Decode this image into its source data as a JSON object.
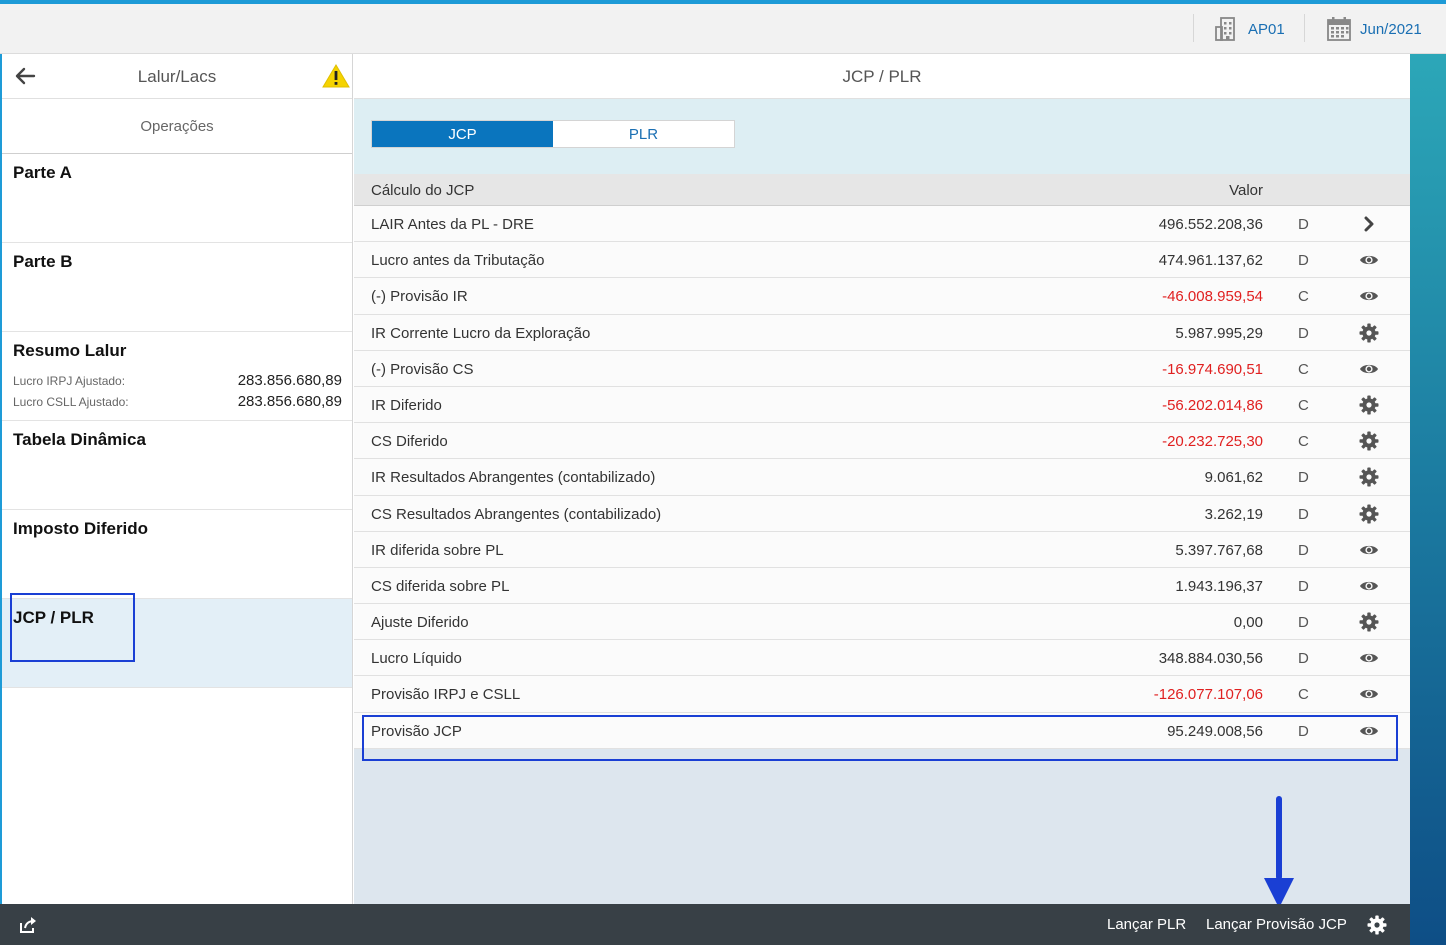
{
  "topbar": {
    "company": {
      "icon": "building-icon",
      "label": "AP01"
    },
    "period": {
      "icon": "calendar-icon",
      "label": "Jun/2021"
    }
  },
  "left_panel": {
    "title": "Lalur/Lacs",
    "back_icon": "back-arrow-icon",
    "warning_icon": "warning-icon",
    "operations_label": "Operações",
    "sections": [
      {
        "title": "Parte A"
      },
      {
        "title": "Parte B"
      },
      {
        "title": "Resumo Lalur",
        "items": [
          {
            "label": "Lucro IRPJ Ajustado:",
            "value": "283.856.680,89"
          },
          {
            "label": "Lucro CSLL Ajustado:",
            "value": "283.856.680,89"
          }
        ]
      },
      {
        "title": "Tabela Dinâmica"
      },
      {
        "title": "Imposto Diferido"
      },
      {
        "title": "JCP / PLR",
        "active": true
      }
    ]
  },
  "main": {
    "title": "JCP / PLR",
    "tabs": [
      {
        "label": "JCP",
        "selected": true
      },
      {
        "label": "PLR",
        "selected": false
      }
    ],
    "table": {
      "col_label": "Cálculo do JCP",
      "col_value": "Valor",
      "rows": [
        {
          "label": "LAIR Antes da PL - DRE",
          "value": "496.552.208,36",
          "dc": "D",
          "action": "chevron-right-icon",
          "negative": false
        },
        {
          "label": "Lucro antes da Tributação",
          "value": "474.961.137,62",
          "dc": "D",
          "action": "eye-icon",
          "negative": false
        },
        {
          "label": "(-) Provisão IR",
          "value": "-46.008.959,54",
          "dc": "C",
          "action": "eye-icon",
          "negative": true
        },
        {
          "label": "IR Corrente Lucro da Exploração",
          "value": "5.987.995,29",
          "dc": "D",
          "action": "gear-icon",
          "negative": false
        },
        {
          "label": "(-) Provisão CS",
          "value": "-16.974.690,51",
          "dc": "C",
          "action": "eye-icon",
          "negative": true
        },
        {
          "label": "IR Diferido",
          "value": "-56.202.014,86",
          "dc": "C",
          "action": "gear-icon",
          "negative": true
        },
        {
          "label": "CS Diferido",
          "value": "-20.232.725,30",
          "dc": "C",
          "action": "gear-icon",
          "negative": true
        },
        {
          "label": "IR Resultados Abrangentes (contabilizado)",
          "value": "9.061,62",
          "dc": "D",
          "action": "gear-icon",
          "negative": false
        },
        {
          "label": "CS Resultados Abrangentes (contabilizado)",
          "value": "3.262,19",
          "dc": "D",
          "action": "gear-icon",
          "negative": false
        },
        {
          "label": "IR diferida sobre PL",
          "value": "5.397.767,68",
          "dc": "D",
          "action": "eye-icon",
          "negative": false
        },
        {
          "label": "CS diferida sobre PL",
          "value": "1.943.196,37",
          "dc": "D",
          "action": "eye-icon",
          "negative": false
        },
        {
          "label": "Ajuste Diferido",
          "value": "0,00",
          "dc": "D",
          "action": "gear-icon",
          "negative": false
        },
        {
          "label": "Lucro Líquido",
          "value": "348.884.030,56",
          "dc": "D",
          "action": "eye-icon",
          "negative": false
        },
        {
          "label": "Provisão IRPJ e CSLL",
          "value": "-126.077.107,06",
          "dc": "C",
          "action": "eye-icon",
          "negative": true
        },
        {
          "label": "Provisão JCP",
          "value": "95.249.008,56",
          "dc": "D",
          "action": "eye-icon",
          "negative": false
        }
      ]
    }
  },
  "footer": {
    "share_icon": "share-icon",
    "buttons": [
      {
        "label": "Lançar PLR"
      },
      {
        "label": "Lançar Provisão JCP"
      }
    ],
    "settings_icon": "gear-icon"
  },
  "colors": {
    "accent": "#0a75be",
    "negative": "#e02020",
    "highlight_box": "#1a3fd4",
    "footer": "#384046"
  }
}
